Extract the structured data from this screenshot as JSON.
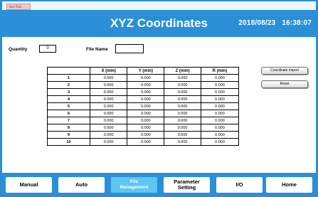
{
  "window": {
    "mini_title": "Sort Tool"
  },
  "header": {
    "title": "XYZ Coordinates",
    "date": "2018/08/23",
    "time": "16:38:07"
  },
  "fields": {
    "quantity_label": "Quantity",
    "quantity_value": "0",
    "file_name_label": "File Name",
    "file_name_value": ""
  },
  "table": {
    "columns": [
      "X (mm)",
      "Y (mm)",
      "Z (mm)",
      "R (mm)"
    ],
    "rows": [
      {
        "index": "1",
        "x": "0.000",
        "y": "0.000",
        "z": "0.000",
        "r": "0.000"
      },
      {
        "index": "2",
        "x": "0.000",
        "y": "0.000",
        "z": "0.000",
        "r": "0.000"
      },
      {
        "index": "3",
        "x": "0.000",
        "y": "0.000",
        "z": "0.000",
        "r": "0.000"
      },
      {
        "index": "4",
        "x": "0.000",
        "y": "0.000",
        "z": "0.000",
        "r": "0.000"
      },
      {
        "index": "5",
        "x": "0.000",
        "y": "0.000",
        "z": "0.000",
        "r": "0.000"
      },
      {
        "index": "6",
        "x": "0.000",
        "y": "0.000",
        "z": "0.000",
        "r": "0.000"
      },
      {
        "index": "7",
        "x": "0.000",
        "y": "0.000",
        "z": "0.000",
        "r": "0.000"
      },
      {
        "index": "8",
        "x": "0.000",
        "y": "0.000",
        "z": "0.000",
        "r": "0.000"
      },
      {
        "index": "9",
        "x": "0.000",
        "y": "0.000",
        "z": "0.000",
        "r": "0.000"
      },
      {
        "index": "10",
        "x": "0.000",
        "y": "0.000",
        "z": "0.000",
        "r": "0.000"
      }
    ]
  },
  "actions": {
    "coordinate_import": "Coordinate import",
    "reset": "Reset"
  },
  "nav": {
    "manual": "Manual",
    "auto": "Auto",
    "file_management_line1": "File",
    "file_management_line2": "Management",
    "parameter_setting_line1": "Parameter",
    "parameter_setting_line2": "Setting",
    "io": "I/O",
    "home": "Home"
  },
  "colors": {
    "accent": "#2a8fd6",
    "active_tab": "#5fc6f2"
  }
}
